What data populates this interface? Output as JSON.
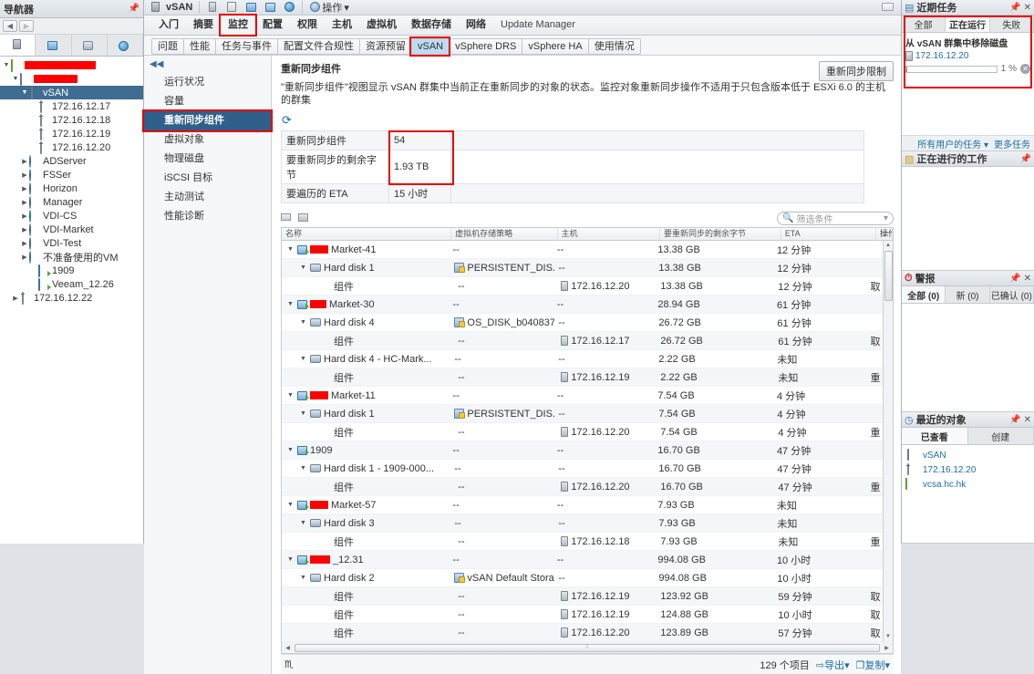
{
  "navigator": {
    "title": "导航器",
    "pin_icon": "pin-icon",
    "back_icon": "back-arrow-icon",
    "forward_icon": "forward-arrow-icon",
    "tabs": [
      {
        "name": "hosts-clusters-tab",
        "icon": "host-icon"
      },
      {
        "name": "vms-templates-tab",
        "icon": "vm-template-icon"
      },
      {
        "name": "storage-tab",
        "icon": "datastore-icon"
      },
      {
        "name": "networking-tab",
        "icon": "network-icon"
      }
    ],
    "tree": [
      {
        "label": "",
        "icon": "vcenter-icon",
        "indent": 0,
        "arrow": "▼",
        "redacted": 78,
        "selected": false
      },
      {
        "label": "",
        "icon": "datacenter-icon",
        "indent": 1,
        "arrow": "▼",
        "redacted": 48,
        "selected": false
      },
      {
        "label": "vSAN",
        "icon": "cluster-icon",
        "indent": 2,
        "arrow": "▼",
        "selected": true
      },
      {
        "label": "172.16.12.17",
        "icon": "host-icon",
        "indent": 3,
        "arrow": "",
        "selected": false
      },
      {
        "label": "172.16.12.18",
        "icon": "host-icon",
        "indent": 3,
        "arrow": "",
        "selected": false
      },
      {
        "label": "172.16.12.19",
        "icon": "host-icon",
        "indent": 3,
        "arrow": "",
        "selected": false
      },
      {
        "label": "172.16.12.20",
        "icon": "host-icon",
        "indent": 3,
        "arrow": "",
        "selected": false
      },
      {
        "label": "ADServer",
        "icon": "vm-folder-icon",
        "indent": 2,
        "arrow": "▶",
        "selected": false
      },
      {
        "label": "FSSer",
        "icon": "vm-folder-icon",
        "indent": 2,
        "arrow": "▶",
        "selected": false
      },
      {
        "label": "Horizon",
        "icon": "vm-folder-icon",
        "indent": 2,
        "arrow": "▶",
        "selected": false
      },
      {
        "label": "Manager",
        "icon": "vm-folder-icon",
        "indent": 2,
        "arrow": "▶",
        "selected": false
      },
      {
        "label": "VDI-CS",
        "icon": "vm-folder-icon",
        "indent": 2,
        "arrow": "▶",
        "selected": false
      },
      {
        "label": "VDI-Market",
        "icon": "vm-folder-icon",
        "indent": 2,
        "arrow": "▶",
        "selected": false
      },
      {
        "label": "VDI-Test",
        "icon": "vm-folder-icon",
        "indent": 2,
        "arrow": "▶",
        "selected": false
      },
      {
        "label": "不准备使用的VM",
        "icon": "vm-folder-icon",
        "indent": 2,
        "arrow": "▶",
        "selected": false
      },
      {
        "label": "1909",
        "icon": "vm-icon",
        "indent": 3,
        "arrow": "",
        "selected": false
      },
      {
        "label": "Veeam_12.26",
        "icon": "vm-icon",
        "indent": 3,
        "arrow": "",
        "selected": false
      },
      {
        "label": "172.16.12.22",
        "icon": "host-icon",
        "indent": 1,
        "arrow": "▶",
        "selected": false
      }
    ]
  },
  "object_bar": {
    "object_name": "vSAN",
    "object_icon": "cluster-icon",
    "toolbar_icons": [
      "add-host-icon",
      "move-host-icon",
      "new-vm-icon",
      "new-resource-pool-icon",
      "deploy-ovf-icon"
    ],
    "actions_label": "操作",
    "actions_icon": "gear-icon",
    "actions_caret": "▾",
    "filter_menu_icon": "list-menu-icon"
  },
  "main_tabs": [
    {
      "label": "入门",
      "active": false,
      "highlighted": false
    },
    {
      "label": "摘要",
      "active": false,
      "highlighted": false
    },
    {
      "label": "监控",
      "active": true,
      "highlighted": true
    },
    {
      "label": "配置",
      "active": false,
      "highlighted": false
    },
    {
      "label": "权限",
      "active": false,
      "highlighted": false
    },
    {
      "label": "主机",
      "active": false,
      "highlighted": false
    },
    {
      "label": "虚拟机",
      "active": false,
      "highlighted": false
    },
    {
      "label": "数据存储",
      "active": false,
      "highlighted": false
    },
    {
      "label": "网络",
      "active": false,
      "highlighted": false
    },
    {
      "label": "Update Manager",
      "active": false,
      "highlighted": false,
      "plain": true
    }
  ],
  "sub_tabs": [
    {
      "label": "问题",
      "active": false,
      "highlighted": false
    },
    {
      "label": "性能",
      "active": false,
      "highlighted": false
    },
    {
      "label": "任务与事件",
      "active": false,
      "highlighted": false
    },
    {
      "label": "配置文件合规性",
      "active": false,
      "highlighted": false
    },
    {
      "label": "资源预留",
      "active": false,
      "highlighted": false
    },
    {
      "label": "vSAN",
      "active": true,
      "highlighted": true
    },
    {
      "label": "vSphere DRS",
      "active": false,
      "highlighted": false
    },
    {
      "label": "vSphere HA",
      "active": false,
      "highlighted": false
    },
    {
      "label": "使用情况",
      "active": false,
      "highlighted": false
    }
  ],
  "side_menu": {
    "collapse_icon": "collapse-left-icon",
    "items": [
      {
        "label": "运行状况",
        "active": false,
        "highlighted": false
      },
      {
        "label": "容量",
        "active": false,
        "highlighted": false
      },
      {
        "label": "重新同步组件",
        "active": true,
        "highlighted": true
      },
      {
        "label": "虚拟对象",
        "active": false,
        "highlighted": false
      },
      {
        "label": "物理磁盘",
        "active": false,
        "highlighted": false
      },
      {
        "label": "iSCSI 目标",
        "active": false,
        "highlighted": false
      },
      {
        "label": "主动测试",
        "active": false,
        "highlighted": false
      },
      {
        "label": "性能诊断",
        "active": false,
        "highlighted": false
      }
    ]
  },
  "pane": {
    "title": "重新同步组件",
    "resync_limit_button": "重新同步限制",
    "description": "\"重新同步组件\"视图显示 vSAN 群集中当前正在重新同步的对象的状态。监控对象重新同步操作不适用于只包含版本低于 ESXi 6.0 的主机的群集",
    "refresh_icon": "refresh-icon",
    "summary": [
      {
        "key": "重新同步组件",
        "value": "54"
      },
      {
        "key": "要重新同步的剩余字节",
        "value": "1.93 TB"
      },
      {
        "key": "要遍历的 ETA",
        "value": "15 小时"
      }
    ]
  },
  "table": {
    "tools": [
      "expand-all-icon",
      "collapse-all-icon"
    ],
    "filter_placeholder": "筛选条件",
    "filter_icon": "search-icon",
    "filter_caret": "▾",
    "columns": [
      {
        "label": "名称",
        "key": "name"
      },
      {
        "label": "虚拟机存储策略",
        "key": "policy"
      },
      {
        "label": "主机",
        "key": "host"
      },
      {
        "label": "要重新同步的剩余字节",
        "key": "bytes"
      },
      {
        "label": "ETA",
        "key": "eta"
      },
      {
        "label": "操作",
        "key": "action"
      }
    ],
    "rows": [
      {
        "name": "Market-41",
        "icon": "vm-icon",
        "level": 1,
        "arrow": "▼",
        "redacted": 20,
        "policy": "--",
        "host": "",
        "bytes": "13.38 GB",
        "eta": "12 分钟",
        "action": ""
      },
      {
        "name": "Hard disk 1",
        "icon": "disk-icon",
        "level": 2,
        "arrow": "▼",
        "policy": "PERSISTENT_DIS...",
        "policy_icon": "storage-policy-icon",
        "host": "",
        "bytes": "13.38 GB",
        "eta": "12 分钟",
        "action": ""
      },
      {
        "name": "组件",
        "icon": "",
        "level": 3,
        "arrow": "",
        "policy": "--",
        "host": "172.16.12.20",
        "bytes": "13.38 GB",
        "eta": "12 分钟",
        "action": "取"
      },
      {
        "name": "Market-30",
        "icon": "vm-icon",
        "level": 1,
        "arrow": "▼",
        "redacted": 18,
        "policy": "--",
        "host": "",
        "bytes": "28.94 GB",
        "eta": "61 分钟",
        "action": ""
      },
      {
        "name": "Hard disk 4",
        "icon": "disk-icon",
        "level": 2,
        "arrow": "▼",
        "policy": "OS_DISK_b040837...",
        "policy_icon": "storage-policy-icon",
        "host": "",
        "bytes": "26.72 GB",
        "eta": "61 分钟",
        "action": ""
      },
      {
        "name": "组件",
        "icon": "",
        "level": 3,
        "arrow": "",
        "policy": "--",
        "host": "172.16.12.17",
        "bytes": "26.72 GB",
        "eta": "61 分钟",
        "action": "取"
      },
      {
        "name": "Hard disk 4 - HC-Mark...",
        "icon": "disk-icon",
        "level": 2,
        "arrow": "▼",
        "policy": "--",
        "host": "",
        "bytes": "2.22 GB",
        "eta": "未知",
        "action": ""
      },
      {
        "name": "组件",
        "icon": "",
        "level": 3,
        "arrow": "",
        "policy": "--",
        "host": "172.16.12.19",
        "bytes": "2.22 GB",
        "eta": "未知",
        "action": "重"
      },
      {
        "name": "Market-11",
        "icon": "vm-icon",
        "level": 1,
        "arrow": "▼",
        "redacted": 20,
        "policy": "--",
        "host": "",
        "bytes": "7.54 GB",
        "eta": "4 分钟",
        "action": ""
      },
      {
        "name": "Hard disk 1",
        "icon": "disk-icon",
        "level": 2,
        "arrow": "▼",
        "policy": "PERSISTENT_DIS...",
        "policy_icon": "storage-policy-icon",
        "host": "",
        "bytes": "7.54 GB",
        "eta": "4 分钟",
        "action": ""
      },
      {
        "name": "组件",
        "icon": "",
        "level": 3,
        "arrow": "",
        "policy": "--",
        "host": "172.16.12.20",
        "bytes": "7.54 GB",
        "eta": "4 分钟",
        "action": "重"
      },
      {
        "name": "1909",
        "icon": "vm-icon",
        "level": 1,
        "arrow": "▼",
        "policy": "--",
        "host": "",
        "bytes": "16.70 GB",
        "eta": "47 分钟",
        "action": ""
      },
      {
        "name": "Hard disk 1 - 1909-000...",
        "icon": "disk-icon",
        "level": 2,
        "arrow": "▼",
        "policy": "--",
        "host": "",
        "bytes": "16.70 GB",
        "eta": "47 分钟",
        "action": ""
      },
      {
        "name": "组件",
        "icon": "",
        "level": 3,
        "arrow": "",
        "policy": "--",
        "host": "172.16.12.20",
        "bytes": "16.70 GB",
        "eta": "47 分钟",
        "action": "重"
      },
      {
        "name": "Market-57",
        "icon": "vm-icon",
        "level": 1,
        "arrow": "▼",
        "redacted": 20,
        "policy": "--",
        "host": "",
        "bytes": "7.93 GB",
        "eta": "未知",
        "action": ""
      },
      {
        "name": "Hard disk 3",
        "icon": "disk-icon",
        "level": 2,
        "arrow": "▼",
        "policy": "--",
        "host": "",
        "bytes": "7.93 GB",
        "eta": "未知",
        "action": ""
      },
      {
        "name": "组件",
        "icon": "",
        "level": 3,
        "arrow": "",
        "policy": "--",
        "host": "172.16.12.18",
        "bytes": "7.93 GB",
        "eta": "未知",
        "action": "重"
      },
      {
        "name": "_12.31",
        "icon": "vm-icon",
        "level": 1,
        "arrow": "▼",
        "redacted": 22,
        "policy": "--",
        "host": "",
        "bytes": "994.08 GB",
        "eta": "10 小时",
        "action": ""
      },
      {
        "name": "Hard disk 2",
        "icon": "disk-icon",
        "level": 2,
        "arrow": "▼",
        "policy": "vSAN Default Stora...",
        "policy_icon": "storage-policy-icon",
        "host": "",
        "bytes": "994.08 GB",
        "eta": "10 小时",
        "action": ""
      },
      {
        "name": "组件",
        "icon": "",
        "level": 3,
        "arrow": "",
        "policy": "--",
        "host": "172.16.12.19",
        "bytes": "123.92 GB",
        "eta": "59 分钟",
        "action": "取"
      },
      {
        "name": "组件",
        "icon": "",
        "level": 3,
        "arrow": "",
        "policy": "--",
        "host": "172.16.12.19",
        "bytes": "124.88 GB",
        "eta": "10 小时",
        "action": "取"
      },
      {
        "name": "组件",
        "icon": "",
        "level": 3,
        "arrow": "",
        "policy": "--",
        "host": "172.16.12.20",
        "bytes": "123.89 GB",
        "eta": "57 分钟",
        "action": "取"
      }
    ],
    "footer": {
      "icon": "list-icon",
      "count": "129 个项目",
      "export_label": "导出",
      "export_icon": "export-icon",
      "copy_label": "复制",
      "copy_icon": "copy-icon",
      "caret": "▾"
    }
  },
  "right": {
    "recent_tasks": {
      "title": "近期任务",
      "icon": "tasks-icon",
      "pin_icon": "pin-icon",
      "close_icon": "close-icon",
      "tabs": [
        {
          "label": "全部",
          "active": false
        },
        {
          "label": "正在运行",
          "active": true
        },
        {
          "label": "失败",
          "active": false
        }
      ],
      "task": {
        "name": "从 vSAN 群集中移除磁盘",
        "target": "172.16.12.20",
        "target_icon": "host-icon",
        "progress": "1 %",
        "progress_value": 1,
        "cancel_icon": "cancel-icon"
      },
      "footer": {
        "all_users_label": "所有用户的任务",
        "caret": "▾",
        "more_tasks_label": "更多任务"
      }
    },
    "work_in_progress": {
      "title": "正在进行的工作",
      "icon": "work-icon",
      "pin_icon": "pin-icon"
    },
    "alarms": {
      "title": "警报",
      "icon": "alarm-icon",
      "pin_icon": "pin-icon",
      "close_icon": "close-icon",
      "tabs": [
        {
          "label": "全部 (0)",
          "active": true
        },
        {
          "label": "新 (0)",
          "active": false
        },
        {
          "label": "已确认 (0)",
          "active": false
        }
      ]
    },
    "recent_objects": {
      "title": "最近的对象",
      "icon": "history-icon",
      "pin_icon": "pin-icon",
      "close_icon": "close-icon",
      "tabs": [
        {
          "label": "已查看",
          "active": true
        },
        {
          "label": "创建",
          "active": false
        }
      ],
      "items": [
        {
          "label": "vSAN",
          "icon": "cluster-icon"
        },
        {
          "label": "172.16.12.20",
          "icon": "host-icon"
        },
        {
          "label": "vcsa.hc.hk",
          "icon": "vcenter-icon"
        }
      ]
    }
  },
  "colors": {
    "highlight_red": "#e60000",
    "selection_blue": "#2f5f8a",
    "link_blue": "#1c6ea4",
    "redaction_red": "#fe0000",
    "progress_green": "#5aa020"
  }
}
